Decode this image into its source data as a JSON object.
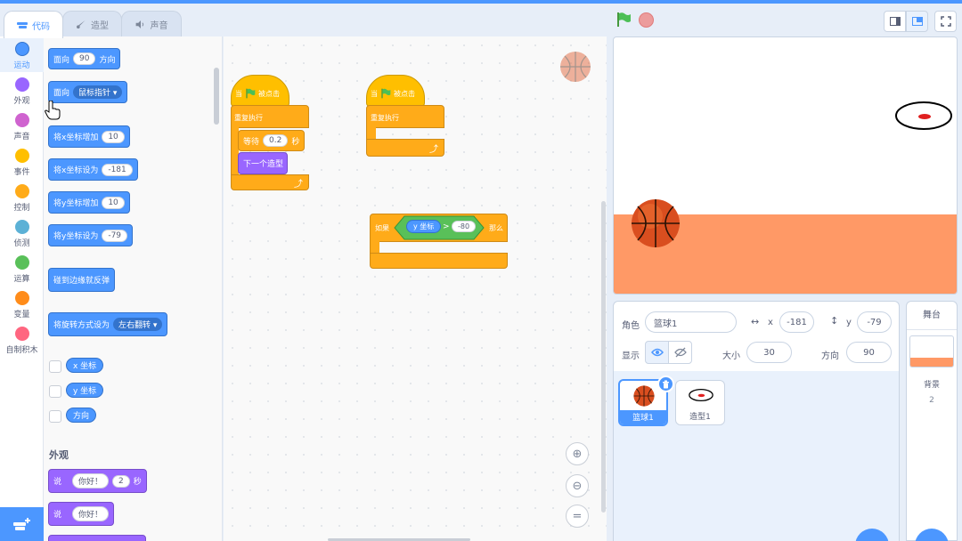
{
  "tabs": {
    "code": "代码",
    "costumes": "造型",
    "sounds": "声音"
  },
  "categories": [
    {
      "label": "运动",
      "color": "#4c97ff"
    },
    {
      "label": "外观",
      "color": "#9966ff"
    },
    {
      "label": "声音",
      "color": "#cf63cf"
    },
    {
      "label": "事件",
      "color": "#ffbf00"
    },
    {
      "label": "控制",
      "color": "#ffab19"
    },
    {
      "label": "侦测",
      "color": "#5cb1d6"
    },
    {
      "label": "运算",
      "color": "#59c059"
    },
    {
      "label": "变量",
      "color": "#ff8c1a"
    },
    {
      "label": "自制积木",
      "color": "#ff6680"
    }
  ],
  "palette": {
    "point_dir": {
      "a": "面向",
      "v": "90",
      "b": "方向"
    },
    "point_towards": {
      "a": "面向",
      "v": "鼠标指针"
    },
    "change_x": {
      "a": "将x坐标增加",
      "v": "10"
    },
    "set_x": {
      "a": "将x坐标设为",
      "v": "-181"
    },
    "change_y": {
      "a": "将y坐标增加",
      "v": "10"
    },
    "set_y": {
      "a": "将y坐标设为",
      "v": "-79"
    },
    "bounce": "碰到边缘就反弹",
    "rot_style": {
      "a": "将旋转方式设为",
      "v": "左右翻转"
    },
    "rep_x": "x 坐标",
    "rep_y": "y 坐标",
    "rep_dir": "方向",
    "looks_header": "外观",
    "say_for": {
      "a": "说",
      "v": "你好！",
      "n": "2",
      "b": "秒"
    },
    "say": {
      "a": "说",
      "v": "你好！"
    }
  },
  "scripts": {
    "s1": {
      "hat": "当",
      "hat_b": "被点击",
      "forever": "重复执行",
      "wait": "等待",
      "wait_v": "0.2",
      "wait_b": "秒",
      "next": "下一个造型"
    },
    "s2": {
      "hat": "当",
      "hat_b": "被点击",
      "forever": "重复执行"
    },
    "s3": {
      "if": "如果",
      "rep": "y 坐标",
      "op": ">",
      "v": "-80",
      "then": "那么"
    }
  },
  "sprite_info": {
    "sprite_label": "角色",
    "sprite_name": "篮球1",
    "x_label": "x",
    "x_value": "-181",
    "y_label": "y",
    "y_value": "-79",
    "show_label": "显示",
    "size_label": "大小",
    "size_value": "30",
    "dir_label": "方向",
    "dir_value": "90"
  },
  "sprites": [
    "篮球1",
    "造型1"
  ],
  "stage_panel": {
    "title": "舞台",
    "backdrop_label": "背景",
    "backdrop_count": "2"
  },
  "colors": {
    "accent": "#4c97ff",
    "ground": "#ff9966",
    "delete": "#4c97ff"
  }
}
